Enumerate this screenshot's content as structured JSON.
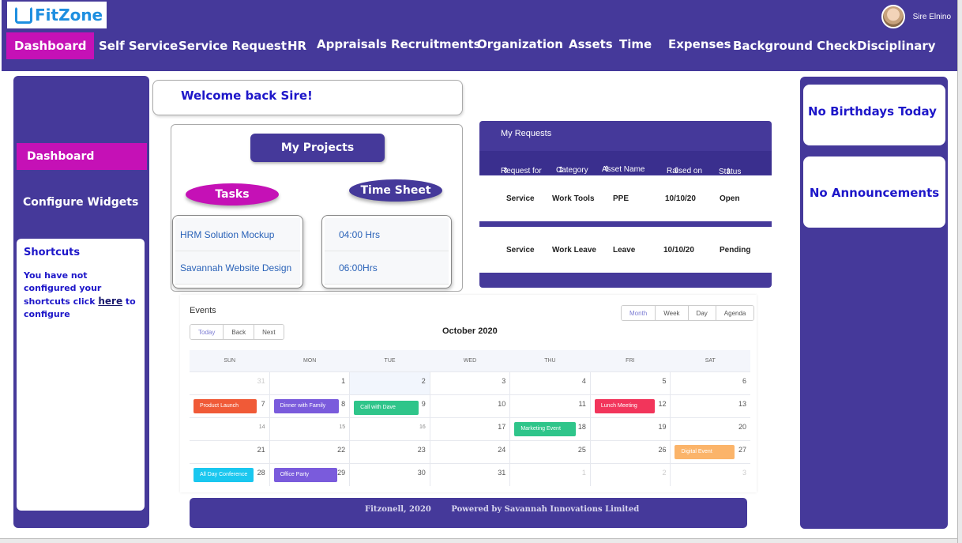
{
  "brand": {
    "name": "FitZone"
  },
  "user": {
    "name": "Sire Elnino"
  },
  "nav": [
    {
      "label": "Dashboard",
      "active": true
    },
    {
      "label": "Self Service"
    },
    {
      "label": "Service Request"
    },
    {
      "label": "HR"
    },
    {
      "label": "Appraisals"
    },
    {
      "label": "Recruitments"
    },
    {
      "label": "Organization"
    },
    {
      "label": "Assets"
    },
    {
      "label": "Time"
    },
    {
      "label": "Expenses"
    },
    {
      "label": "Background Check"
    },
    {
      "label": "Disciplinary"
    }
  ],
  "sidebar": {
    "dashboard": "Dashboard",
    "configure": "Configure Widgets",
    "shortcuts": {
      "title": "Shortcuts",
      "text_before": "You have not configured your shortcuts click ",
      "link": "here",
      "text_after": " to configure"
    }
  },
  "welcome": "Welcome back Sire!",
  "projects": {
    "title": "My Projects",
    "tasks_label": "Tasks",
    "timesheet_label": "Time Sheet",
    "tasks": [
      "HRM Solution Mockup",
      "Savannah Website Design"
    ],
    "timesheet": [
      "04:00 Hrs",
      "06:00Hrs"
    ]
  },
  "requests": {
    "title": "My Requests",
    "columns": [
      "Request for",
      "Category",
      "Asset Name",
      "Raised on",
      "Status"
    ],
    "rows": [
      [
        "Service",
        "Work Tools",
        "PPE",
        "10/10/20",
        "Open"
      ],
      [
        "Service",
        "Work Leave",
        "Leave",
        "10/10/20",
        "Pending"
      ]
    ]
  },
  "right": {
    "birthdays": "No Birthdays Today",
    "announcements": "No Announcements"
  },
  "calendar": {
    "title": "Events",
    "month": "October 2020",
    "nav_buttons": [
      "Today",
      "Back",
      "Next"
    ],
    "view_buttons": [
      "Month",
      "Week",
      "Day",
      "Agenda"
    ],
    "active_view": "Month",
    "days_of_week": [
      "SUN",
      "MON",
      "TUE",
      "WED",
      "THU",
      "FRI",
      "SAT"
    ],
    "weeks": [
      [
        {
          "d": "31",
          "faded": true
        },
        {
          "d": "1"
        },
        {
          "d": "2",
          "today": true
        },
        {
          "d": "3"
        },
        {
          "d": "4"
        },
        {
          "d": "5"
        },
        {
          "d": "6"
        }
      ],
      [
        {
          "d": "7"
        },
        {
          "d": "8"
        },
        {
          "d": "9"
        },
        {
          "d": "10"
        },
        {
          "d": "11"
        },
        {
          "d": "12"
        },
        {
          "d": "13"
        }
      ],
      [
        {
          "d": "14",
          "small": true
        },
        {
          "d": "15",
          "small": true
        },
        {
          "d": "16",
          "small": true
        },
        {
          "d": "17"
        },
        {
          "d": "18"
        },
        {
          "d": "19"
        },
        {
          "d": "20"
        }
      ],
      [
        {
          "d": "21"
        },
        {
          "d": "22"
        },
        {
          "d": "23"
        },
        {
          "d": "24"
        },
        {
          "d": "25"
        },
        {
          "d": "26"
        },
        {
          "d": "27"
        }
      ],
      [
        {
          "d": "28"
        },
        {
          "d": "29"
        },
        {
          "d": "30"
        },
        {
          "d": "31"
        },
        {
          "d": "1",
          "faded": true
        },
        {
          "d": "2",
          "faded": true
        },
        {
          "d": "3",
          "faded": true
        }
      ]
    ],
    "events": [
      {
        "label": "Product Launch",
        "week": 1,
        "day": 0,
        "color": "#f05a37",
        "width": 80
      },
      {
        "label": "Dinner with Family",
        "week": 1,
        "day": 1,
        "color": "#7a5bdc",
        "width": 82
      },
      {
        "label": "Call with Dave",
        "week": 1,
        "day": 2,
        "color": "#2fc58a",
        "width": 82,
        "offset": 7
      },
      {
        "label": "Lunch Meeting",
        "week": 1,
        "day": 5,
        "color": "#f2355b",
        "width": 76
      },
      {
        "label": "Marketing Event",
        "week": 2,
        "day": 4,
        "color": "#2fc58a",
        "width": 78
      },
      {
        "label": "Digital Event",
        "week": 3,
        "day": 6,
        "color": "#fbb46a",
        "width": 76
      },
      {
        "label": "All Day Conference",
        "week": 4,
        "day": 0,
        "color": "#1ac7ef",
        "width": 76
      },
      {
        "label": "Office Party",
        "week": 4,
        "day": 1,
        "color": "#7a5bdc",
        "width": 80
      }
    ]
  },
  "footer": {
    "copyright": "Fitzonell, 2020",
    "powered": "Powered by Savannah Innovations Limited"
  },
  "colors": {
    "primary": "#45399a",
    "accent": "#c511b6",
    "text_blue": "#1d16c9"
  }
}
